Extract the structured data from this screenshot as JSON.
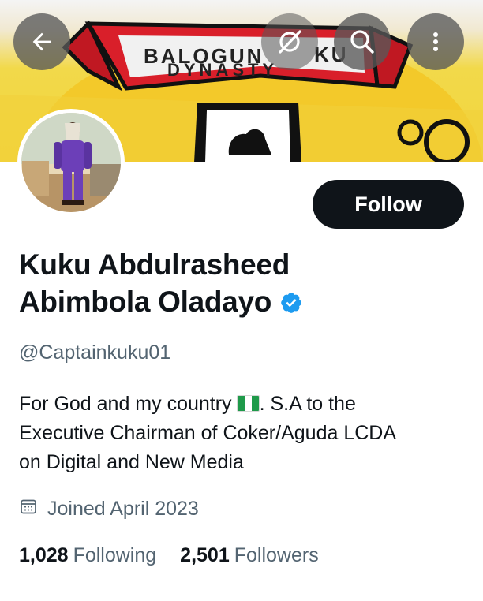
{
  "banner": {
    "title_line1": "BALOGUN",
    "title_line1_tail": "KU",
    "title_line2": "DYNASTY",
    "colors": {
      "yellow": "#f3d53c",
      "red": "#d91f2a",
      "dark": "#111111"
    }
  },
  "top_bar": {
    "back_icon": "arrow-left-icon",
    "grok_icon": "grok-icon",
    "search_icon": "search-icon",
    "more_icon": "more-vertical-icon"
  },
  "profile": {
    "follow_label": "Follow",
    "name_line1": "Kuku Abdulrasheed",
    "name_line2": "Abimbola Oladayo",
    "verified_icon": "verified-badge-icon",
    "verified_color": "#1d9bf0",
    "handle": "@Captainkuku01",
    "bio_line1_before": "For God and my country",
    "bio_line1_after": ".   S.A to the",
    "bio_line2": "Executive Chairman of Coker/Aguda LCDA",
    "bio_line3": "on Digital and New Media",
    "flag_icon": "nigeria-flag-icon",
    "joined": "Joined April 2023",
    "joined_icon": "calendar-icon",
    "following_count": "1,028",
    "following_label": "Following",
    "followers_count": "2,501",
    "followers_label": "Followers"
  },
  "colors": {
    "text_primary": "#0f1419",
    "text_secondary": "#536471",
    "button_bg": "#0f1419",
    "button_text": "#ffffff"
  }
}
